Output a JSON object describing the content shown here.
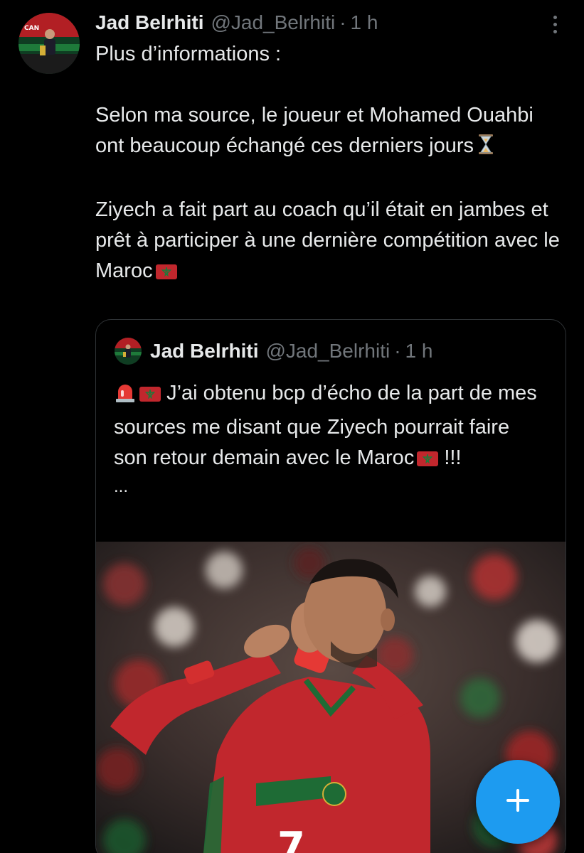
{
  "tweet": {
    "display_name": "Jad Belrhiti",
    "handle": "@Jad_Belrhiti",
    "separator": "·",
    "time": "1 h",
    "line1": "Plus d’informations :",
    "para2_text": "Selon ma source, le joueur et Mohamed Ouahbi ont beaucoup échangé ces derniers jours",
    "para3_text": "Ziyech a fait part au coach qu’il était en jambes et prêt à participer à une dernière compétition avec le Maroc",
    "icons": {
      "more": "more-vertical-icon",
      "hourglass": "hourglass-icon",
      "flag": "morocco-flag-icon"
    }
  },
  "quoted": {
    "display_name": "Jad Belrhiti",
    "handle": "@Jad_Belrhiti",
    "separator": "·",
    "time": "1 h",
    "text_a": "J’ai obtenu bcp d’écho de la part de mes sources me disant que Ziyech pourrait faire son retour demain avec le Maroc",
    "text_b": "!!!",
    "more_text": "...",
    "icons": {
      "siren": "siren-icon",
      "flag": "morocco-flag-icon"
    }
  },
  "fab": {
    "icon": "plus-icon"
  },
  "colors": {
    "background": "#000000",
    "text": "#e7e9ea",
    "muted": "#71767b",
    "border": "#2f3336",
    "accent": "#1d9bf0",
    "jersey_red": "#c1272d"
  }
}
